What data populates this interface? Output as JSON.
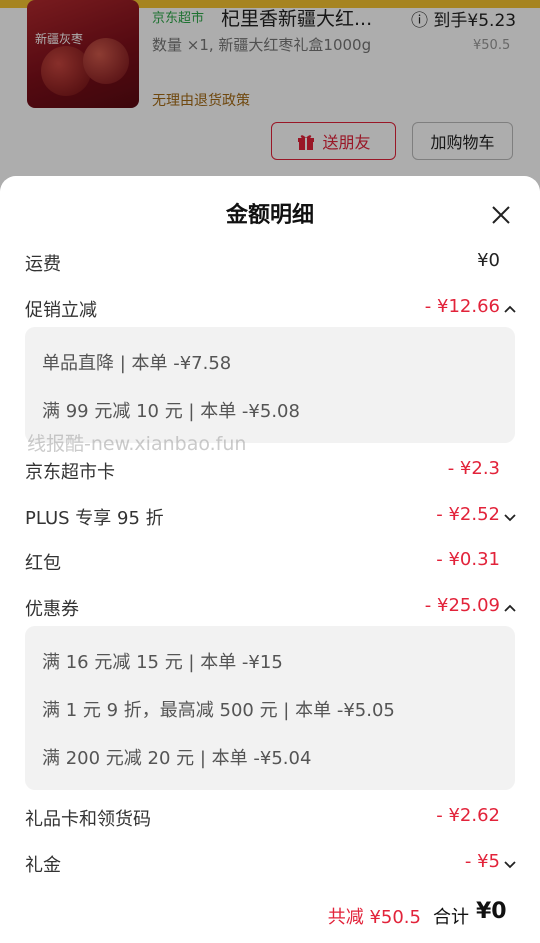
{
  "product": {
    "store_tag": "京东超市",
    "title": "杞里香新疆大红...",
    "price_label": "到手¥5.23",
    "desc": "数量 ×1, 新疆大红枣礼盒1000g",
    "orig_price": "¥50.5",
    "return_policy": "无理由退货政策",
    "img_label": "新疆灰枣",
    "gift_button": "送朋友",
    "cart_button": "加购物车"
  },
  "sheet": {
    "title": "金额明细"
  },
  "rows": {
    "shipping": {
      "label": "运费",
      "value": "¥0"
    },
    "promo": {
      "label": "促销立减",
      "value": "- ¥12.66"
    },
    "jdcard": {
      "label": "京东超市卡",
      "value": "- ¥2.3"
    },
    "plus": {
      "label": "PLUS 专享 95 折",
      "value": "- ¥2.52"
    },
    "redpacket": {
      "label": "红包",
      "value": "- ¥0.31"
    },
    "coupon": {
      "label": "优惠券",
      "value": "- ¥25.09"
    },
    "giftcard": {
      "label": "礼品卡和领货码",
      "value": "- ¥2.62"
    },
    "lijin": {
      "label": "礼金",
      "value": "- ¥5"
    }
  },
  "promo_details": [
    "单品直降 | 本单 -¥7.58",
    "满 99 元减 10 元 | 本单 -¥5.08"
  ],
  "coupon_details": [
    "满 16 元减 15 元 | 本单 -¥15",
    "满 1 元 9 折，最高减 500 元 | 本单 -¥5.05",
    "满 200 元减 20 元 | 本单 -¥5.04"
  ],
  "watermark": "线报酷-new.xianbao.fun",
  "footer": {
    "discount": "共减 ¥50.5",
    "total_label": "合计",
    "total_value": "¥0"
  },
  "colors": {
    "accent_red": "#e2233a",
    "store_green": "#2fa84a",
    "policy_brown": "#a46a16"
  }
}
